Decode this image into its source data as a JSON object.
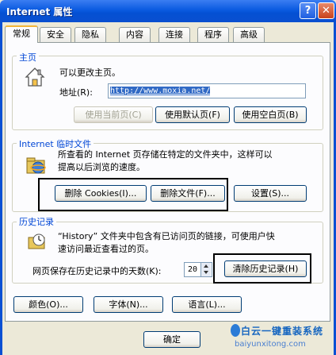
{
  "window": {
    "title": "Internet 属性"
  },
  "title_buttons": {
    "help": "?",
    "close": "✕"
  },
  "tabs": [
    "常规",
    "安全",
    "隐私",
    "内容",
    "连接",
    "程序",
    "高级"
  ],
  "home": {
    "group_title": "主页",
    "hint": "可以更改主页。",
    "address_label": "地址(R):",
    "address_value": "http://www.moxia.net/",
    "buttons": {
      "current": "使用当前页(C)",
      "default": "使用默认页(F)",
      "blank": "使用空白页(B)"
    }
  },
  "temp": {
    "group_title": "Internet 临时文件",
    "desc_line1": "所查看的 Internet 页存储在特定的文件夹中，这样可以",
    "desc_line2": "提高以后浏览的速度。",
    "buttons": {
      "delete_cookies": "删除 Cookies(I)...",
      "delete_files": "删除文件(F)...",
      "settings": "设置(S)..."
    }
  },
  "history": {
    "group_title": "历史记录",
    "desc_line1": "“History” 文件夹中包含有已访问页的链接，可使用户快",
    "desc_line2": "速访问最近查看过的页。",
    "days_label": "网页保存在历史记录中的天数(K):",
    "days_value": "20",
    "clear_button": "清除历史记录(H)"
  },
  "bottom_buttons": {
    "colors": "颜色(O)...",
    "fonts": "字体(N)...",
    "languages": "语言(L)..."
  },
  "dialog_buttons": {
    "ok": "确定"
  },
  "watermark": {
    "main": "白云一键重装系统",
    "sub": "baiyunxitong.com"
  },
  "colors": {
    "accent": "#0046d5",
    "selection": "#316ac5",
    "titlebar": "#0a5ae0"
  }
}
